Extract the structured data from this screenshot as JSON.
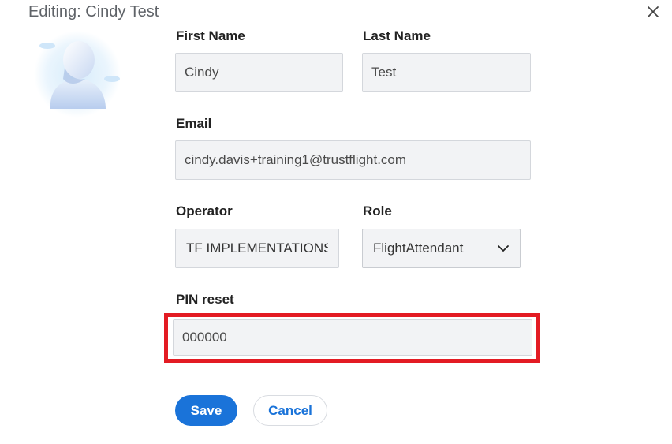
{
  "dialog": {
    "title": "Editing: Cindy Test",
    "close_icon": "close-icon"
  },
  "avatar": {
    "icon": "user-avatar-icon"
  },
  "form": {
    "first_name": {
      "label": "First Name",
      "value": "Cindy"
    },
    "last_name": {
      "label": "Last Name",
      "value": "Test"
    },
    "email": {
      "label": "Email",
      "value": "cindy.davis+training1@trustflight.com"
    },
    "operator": {
      "label": "Operator",
      "value": "TF IMPLEMENTATIONS"
    },
    "role": {
      "label": "Role",
      "value": "FlightAttendant",
      "icon": "chevron-down-icon"
    },
    "pin_reset": {
      "label": "PIN reset",
      "value": "000000"
    }
  },
  "actions": {
    "save_label": "Save",
    "cancel_label": "Cancel"
  },
  "colors": {
    "accent": "#1a73d9",
    "highlight": "#e31b23",
    "field_bg": "#f2f3f5"
  }
}
